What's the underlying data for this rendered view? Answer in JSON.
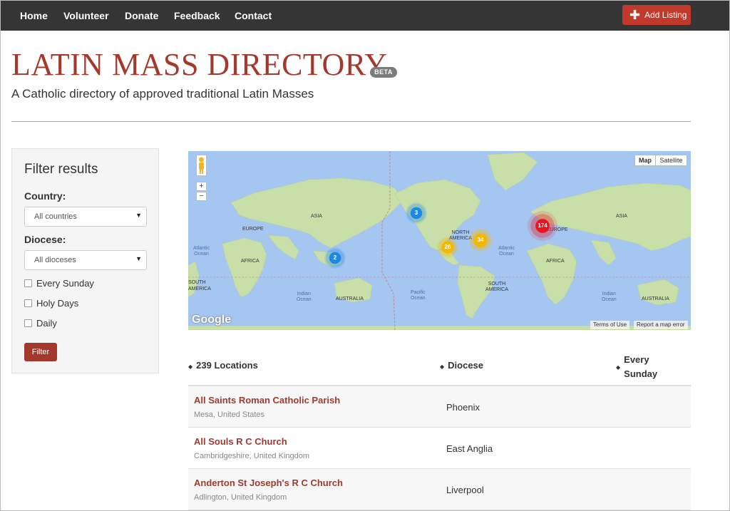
{
  "nav": {
    "items": [
      "Home",
      "Volunteer",
      "Donate",
      "Feedback",
      "Contact"
    ],
    "add_listing": "Add Listing"
  },
  "header": {
    "title": "LATIN MASS DIRECTORY",
    "badge": "BETA",
    "tagline": "A Catholic directory of approved traditional Latin Masses"
  },
  "filter": {
    "title": "Filter results",
    "country_label": "Country:",
    "country_value": "All countries",
    "diocese_label": "Diocese:",
    "diocese_value": "All dioceses",
    "checkboxes": [
      "Every Sunday",
      "Holy Days",
      "Daily"
    ],
    "button": "Filter"
  },
  "map": {
    "type_buttons": [
      "Map",
      "Satellite"
    ],
    "zoom_in": "+",
    "zoom_out": "−",
    "logo": "Google",
    "terms": "Terms of Use",
    "report": "Report a map error",
    "labels": {
      "asia1": "ASIA",
      "europe1": "EUROPE",
      "africa1": "AFRICA",
      "australia1": "AUSTRALIA",
      "south1": "SOUTH",
      "america1": "AMERICA",
      "atlantic1": "Atlantic\nOcean",
      "indian1": "Indian\nOcean",
      "pacific": "Pacific\nOcean",
      "north_america": "NORTH\nAMERICA",
      "atlantic2": "Atlantic\nOcean",
      "south_america": "SOUTH\nAMERICA",
      "europe2": "EUROPE",
      "africa2": "AFRICA",
      "asia2": "ASIA",
      "indian2": "Indian\nOcean",
      "australia2": "AUSTRALIA"
    },
    "clusters": [
      "3",
      "2",
      "26",
      "34",
      "174"
    ]
  },
  "colors": {
    "brand": "#a3392c",
    "navbar": "#353535",
    "cluster_blue": "#1e88e5",
    "cluster_yellow": "#f5b800",
    "cluster_red": "#e8141e"
  },
  "table": {
    "headers": [
      "239 Locations",
      "Diocese",
      "Every\nSunday"
    ],
    "rows": [
      {
        "name": "All Saints Roman Catholic Parish",
        "location": "Mesa, United States",
        "diocese": "Phoenix"
      },
      {
        "name": "All Souls R C Church",
        "location": "Cambridgeshire, United Kingdom",
        "diocese": "East Anglia"
      },
      {
        "name": "Anderton St Joseph's R C Church",
        "location": "Adlington, United Kingdom",
        "diocese": "Liverpool"
      }
    ]
  }
}
